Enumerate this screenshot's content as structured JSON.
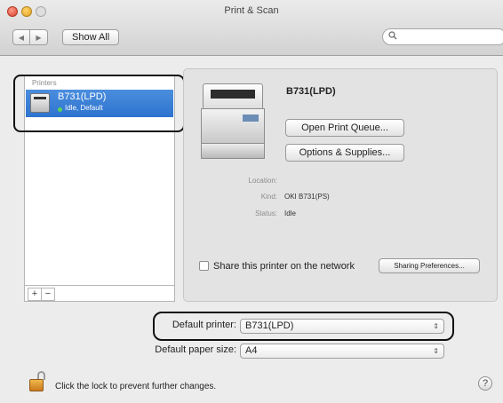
{
  "window": {
    "title": "Print & Scan"
  },
  "toolbar": {
    "back_glyph": "◀",
    "forward_glyph": "▶",
    "show_all_label": "Show All",
    "search_placeholder": "",
    "search_icon": "search-icon"
  },
  "printers": {
    "header": "Printers",
    "items": [
      {
        "name": "B731(LPD)",
        "status": "Idle, Default",
        "selected": true
      }
    ],
    "add_label": "+",
    "remove_label": "−"
  },
  "detail": {
    "name": "B731(LPD)",
    "open_queue_label": "Open Print Queue...",
    "options_label": "Options & Supplies...",
    "location_label": "Location:",
    "location_value": "",
    "kind_label": "Kind:",
    "kind_value": "OKI B731(PS)",
    "status_label": "Status:",
    "status_value": "Idle",
    "share_label": "Share this printer on the network",
    "share_checked": false,
    "sharing_prefs_label": "Sharing Preferences..."
  },
  "defaults": {
    "printer_label": "Default printer:",
    "printer_value": "B731(LPD)",
    "paper_label": "Default paper size:",
    "paper_value": "A4",
    "popup_arrows": "⇕"
  },
  "footer": {
    "lock_text": "Click the lock to prevent further changes.",
    "help_label": "?"
  },
  "colors": {
    "selection": "#2d73cf",
    "window_bg": "#ececec",
    "status_dot": "#5ad45a"
  }
}
